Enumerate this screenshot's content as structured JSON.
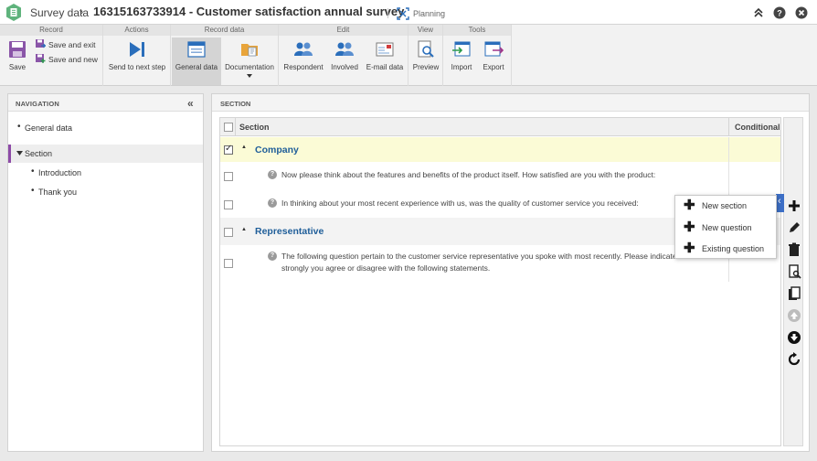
{
  "titlebar": {
    "breadcrumb": "Survey data",
    "separator": "›",
    "record_title": "16315163733914 - Customer satisfaction annual survey",
    "planning_label": "Planning"
  },
  "ribbon": {
    "groups": {
      "record": "Record",
      "actions": "Actions",
      "record_data": "Record data",
      "edit": "Edit",
      "view": "View",
      "tools": "Tools"
    },
    "buttons": {
      "save": "Save",
      "save_and_exit": "Save and exit",
      "save_and_new": "Save and new",
      "send_to_next_step": "Send to next step",
      "general_data": "General data",
      "documentation": "Documentation",
      "respondent": "Respondent",
      "involved": "Involved",
      "email_data": "E-mail data",
      "preview": "Preview",
      "import": "Import",
      "export": "Export"
    }
  },
  "navigation": {
    "title": "NAVIGATION",
    "collapse_glyph": "«",
    "items": [
      {
        "label": "General data"
      },
      {
        "label": "Section"
      },
      {
        "label": "Introduction"
      },
      {
        "label": "Thank you"
      }
    ]
  },
  "section_panel": {
    "title": "SECTION",
    "columns": {
      "section": "Section",
      "conditional": "Conditional"
    },
    "rows": [
      {
        "type": "section",
        "label": "Company",
        "checked": true
      },
      {
        "type": "question",
        "text": "Now please think about the features and benefits of the product itself. How satisfied are you with the product:"
      },
      {
        "type": "question",
        "text": "In thinking about your most recent experience with us, was the quality of customer service you received:"
      },
      {
        "type": "section",
        "label": "Representative",
        "checked": false
      },
      {
        "type": "question",
        "text": "The following question pertain to the customer service representative you spoke with most recently. Please indicate how strongly you agree or disagree with the following statements."
      }
    ]
  },
  "popup_menu": {
    "items": [
      "New section",
      "New question",
      "Existing question"
    ]
  },
  "colors": {
    "accent_purple": "#8d4aa7",
    "section_blue": "#1f5e99",
    "highlight_row": "#fbfbd6",
    "icon_blue": "#3d6fc6"
  }
}
